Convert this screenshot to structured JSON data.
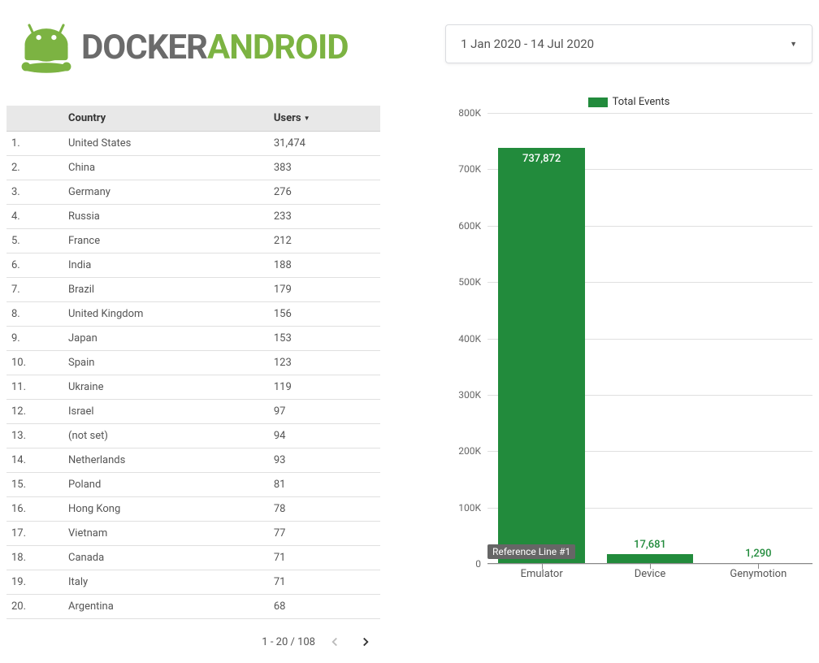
{
  "logo": {
    "text1": "DOCKER",
    "text2": "ANDROID"
  },
  "date_range": "1 Jan 2020 - 14 Jul 2020",
  "table": {
    "headers": {
      "rank": "",
      "country": "Country",
      "users": "Users"
    },
    "rows": [
      {
        "rank": "1.",
        "country": "United States",
        "users": "31,474"
      },
      {
        "rank": "2.",
        "country": "China",
        "users": "383"
      },
      {
        "rank": "3.",
        "country": "Germany",
        "users": "276"
      },
      {
        "rank": "4.",
        "country": "Russia",
        "users": "233"
      },
      {
        "rank": "5.",
        "country": "France",
        "users": "212"
      },
      {
        "rank": "6.",
        "country": "India",
        "users": "188"
      },
      {
        "rank": "7.",
        "country": "Brazil",
        "users": "179"
      },
      {
        "rank": "8.",
        "country": "United Kingdom",
        "users": "156"
      },
      {
        "rank": "9.",
        "country": "Japan",
        "users": "153"
      },
      {
        "rank": "10.",
        "country": "Spain",
        "users": "123"
      },
      {
        "rank": "11.",
        "country": "Ukraine",
        "users": "119"
      },
      {
        "rank": "12.",
        "country": "Israel",
        "users": "97"
      },
      {
        "rank": "13.",
        "country": "(not set)",
        "users": "94"
      },
      {
        "rank": "14.",
        "country": "Netherlands",
        "users": "93"
      },
      {
        "rank": "15.",
        "country": "Poland",
        "users": "81"
      },
      {
        "rank": "16.",
        "country": "Hong Kong",
        "users": "78"
      },
      {
        "rank": "17.",
        "country": "Vietnam",
        "users": "77"
      },
      {
        "rank": "18.",
        "country": "Canada",
        "users": "71"
      },
      {
        "rank": "19.",
        "country": "Italy",
        "users": "71"
      },
      {
        "rank": "20.",
        "country": "Argentina",
        "users": "68"
      }
    ]
  },
  "pagination": {
    "label": "1 - 20 / 108"
  },
  "legend_label": "Total Events",
  "reference_line_label": "Reference Line #1",
  "chart_data": {
    "type": "bar",
    "title": "",
    "categories": [
      "Emulator",
      "Device",
      "Genymotion"
    ],
    "values": [
      737872,
      17681,
      1290
    ],
    "value_labels": [
      "737,872",
      "17,681",
      "1,290"
    ],
    "ylim": [
      0,
      800000
    ],
    "y_ticks": [
      0,
      100000,
      200000,
      300000,
      400000,
      500000,
      600000,
      700000,
      800000
    ],
    "y_tick_labels": [
      "0",
      "100K",
      "200K",
      "300K",
      "400K",
      "500K",
      "600K",
      "700K",
      "800K"
    ],
    "series_name": "Total Events",
    "reference_line": "Reference Line #1"
  }
}
